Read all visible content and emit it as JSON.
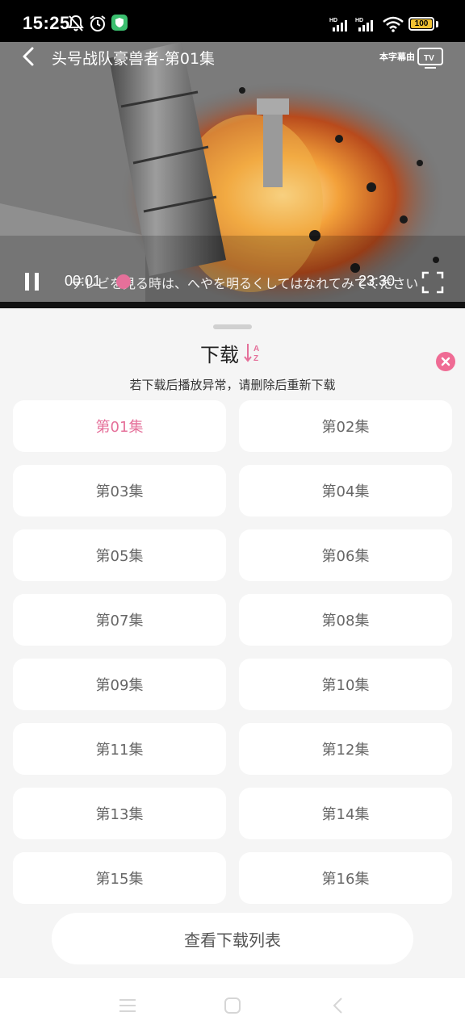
{
  "status_bar": {
    "time": "15:25",
    "battery": "100",
    "icons": [
      "bell-off-icon",
      "alarm-icon",
      "shield-app-icon",
      "hd-signal-icon",
      "hd-signal-icon",
      "wifi-icon",
      "battery-icon"
    ]
  },
  "player": {
    "title": "头号战队豪兽者-第01集",
    "watermark": "本字幕由",
    "subtitle": "テレビを見る時は、へやを明るくしてはなれてみてください",
    "current_time": "00:01",
    "total_time": "23:30",
    "progress": 0.02,
    "icons": [
      "back-icon",
      "tv-cast-icon",
      "pause-icon",
      "fullscreen-icon"
    ]
  },
  "sheet": {
    "title": "下载",
    "hint": "若下载后播放异常，请删除后重新下载",
    "episodes": [
      "第01集",
      "第02集",
      "第03集",
      "第04集",
      "第05集",
      "第06集",
      "第07集",
      "第08集",
      "第09集",
      "第10集",
      "第11集",
      "第12集",
      "第13集",
      "第14集",
      "第15集",
      "第16集"
    ],
    "selected_index": 0,
    "view_list_label": "查看下载列表",
    "accent_color": "#e5709a",
    "close_color": "#ef6b94"
  },
  "nav_bar": {
    "icons": [
      "menu-icon",
      "home-icon",
      "back-nav-icon"
    ]
  }
}
